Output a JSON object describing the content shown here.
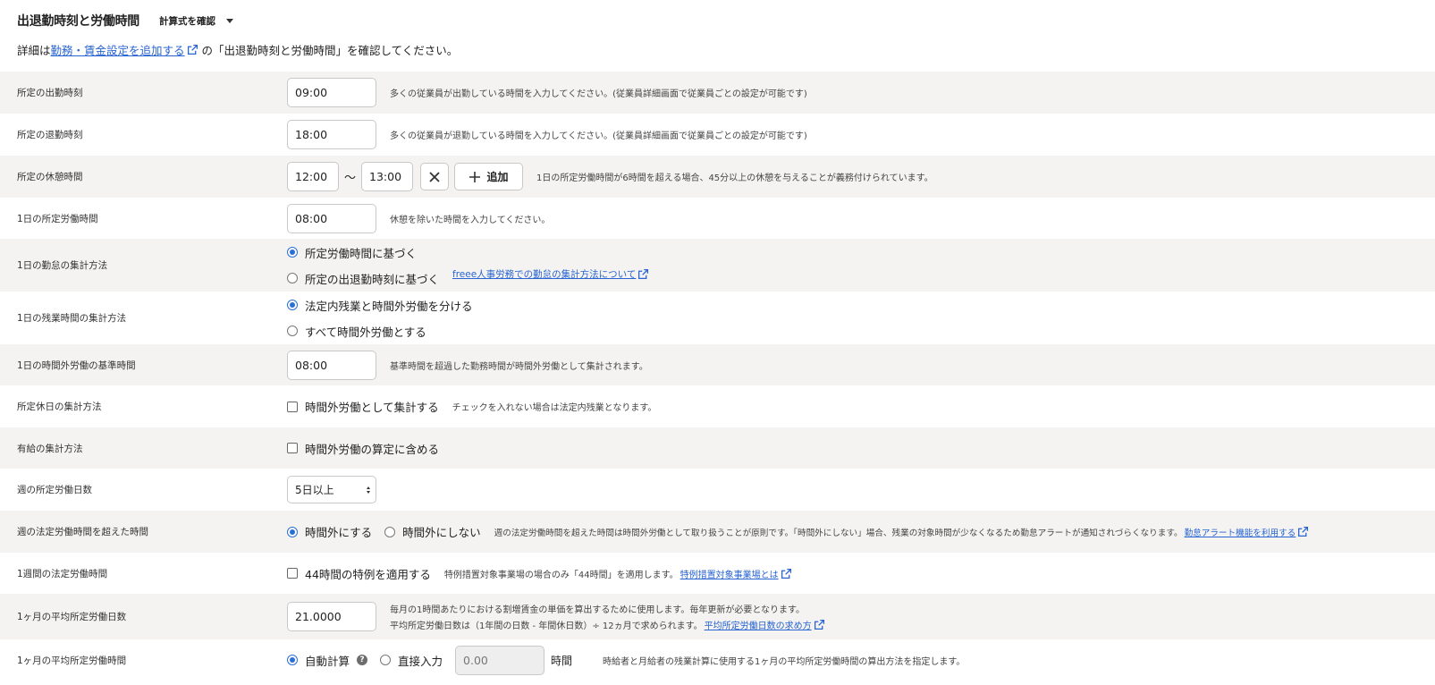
{
  "header": {
    "title": "出退勤時刻と労働時間",
    "formula_label": "計算式を確認",
    "desc_prefix": "詳細は",
    "desc_link": "勤務・賃金設定を追加する",
    "desc_suffix": "の「出退勤時刻と労働時間」を確認してください。"
  },
  "rows": {
    "start": {
      "label": "所定の出勤時刻",
      "value": "09:00",
      "hint": "多くの従業員が出勤している時間を入力してください。(従業員詳細画面で従業員ごとの設定が可能です)"
    },
    "end": {
      "label": "所定の退勤時刻",
      "value": "18:00",
      "hint": "多くの従業員が退勤している時間を入力してください。(従業員詳細画面で従業員ごとの設定が可能です)"
    },
    "break": {
      "label": "所定の休憩時間",
      "from": "12:00",
      "tilde": "〜",
      "to": "13:00",
      "add_label": "追加",
      "hint": "1日の所定労働時間が6時間を超える場合、45分以上の休憩を与えることが義務付けられています。"
    },
    "daily_hours": {
      "label": "1日の所定労働時間",
      "value": "08:00",
      "hint": "休憩を除いた時間を入力してください。"
    },
    "attendance_method": {
      "label": "1日の勤怠の集計方法",
      "option1": "所定労働時間に基づく",
      "option2": "所定の出退勤時刻に基づく",
      "link": "freee人事労務での勤怠の集計方法について"
    },
    "overtime_method": {
      "label": "1日の残業時間の集計方法",
      "option1": "法定内残業と時間外労働を分ける",
      "option2": "すべて時間外労働とする"
    },
    "overtime_base": {
      "label": "1日の時間外労働の基準時間",
      "value": "08:00",
      "hint": "基準時間を超過した勤務時間が時間外労働として集計されます。"
    },
    "holiday_method": {
      "label": "所定休日の集計方法",
      "check_label": "時間外労働として集計する",
      "hint": "チェックを入れない場合は法定内残業となります。"
    },
    "paid_leave_method": {
      "label": "有給の集計方法",
      "check_label": "時間外労働の算定に含める"
    },
    "weekly_days": {
      "label": "週の所定労働日数",
      "selected": "5日以上"
    },
    "weekly_over": {
      "label": "週の法定労働時間を超えた時間",
      "option1": "時間外にする",
      "option2": "時間外にしない",
      "hint": "週の法定労働時間を超えた時間は時間外労働として取り扱うことが原則です。「時間外にしない」場合、残業の対象時間が少なくなるため勤怠アラートが通知されづらくなります。",
      "link": "勤怠アラート機能を利用する"
    },
    "weekly_legal": {
      "label": "1週間の法定労働時間",
      "check_label": "44時間の特例を適用する",
      "hint": "特例措置対象事業場の場合のみ「44時間」を適用します。",
      "link": "特例措置対象事業場とは"
    },
    "monthly_days": {
      "label": "1ヶ月の平均所定労働日数",
      "value": "21.0000",
      "hint1": "毎月の1時間あたりにおける割増賃金の単価を算出するために使用します。毎年更新が必要となります。",
      "hint2": "平均所定労働日数は（1年間の日数 - 年間休日数）÷ 12ヵ月で求められます。",
      "link": "平均所定労働日数の求め方"
    },
    "monthly_hours": {
      "label": "1ヶ月の平均所定労働時間",
      "option1": "自動計算",
      "help": "?",
      "option2": "直接入力",
      "value": "0.00",
      "unit": "時間",
      "hint": "時給者と月給者の残業計算に使用する1ヶ月の平均所定労働時間の算出方法を指定します。"
    }
  },
  "colors": {
    "link": "#2864d2",
    "radio_on": "#2a6fd6",
    "row_gray": "#f4f3f1"
  },
  "icons": {
    "external": "external-link-icon",
    "close": "close-icon",
    "plus": "plus-icon",
    "help": "help-icon"
  }
}
